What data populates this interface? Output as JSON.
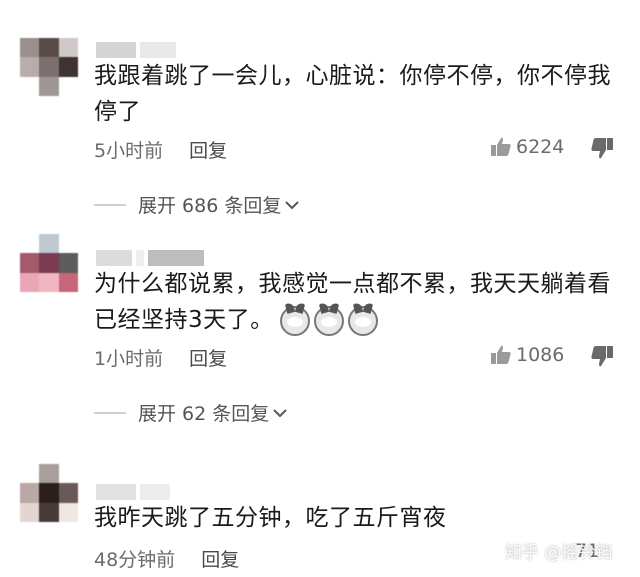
{
  "comments": [
    {
      "text_line1": "我跟着跳了一会儿，心脏说：你停不停，你不停我",
      "text_line2": "停了",
      "time": "5小时前",
      "reply_label": "回复",
      "likes": "6224",
      "expand_label": "展开 686 条回复"
    },
    {
      "text_line1": "为什么都说累，我感觉一点都不累，我天天躺着看",
      "text_line2": "已经坚持3天了。",
      "time": "1小时前",
      "reply_label": "回复",
      "likes": "1086",
      "expand_label": "展开 62 条回复"
    },
    {
      "text_line1": "我昨天跳了五分钟，吃了五斤宵夜",
      "time": "48分钟前",
      "reply_label": "回复",
      "likes_partial": "71"
    }
  ],
  "watermark": "知乎 @摇铃铛",
  "colors": {
    "text": "#1a1a1a",
    "meta": "#6b6b6b",
    "background": "#ffffff"
  },
  "icons": [
    "thumbs-up-icon",
    "thumbs-down-icon",
    "chevron-down-icon",
    "husky-emoji-icon"
  ]
}
